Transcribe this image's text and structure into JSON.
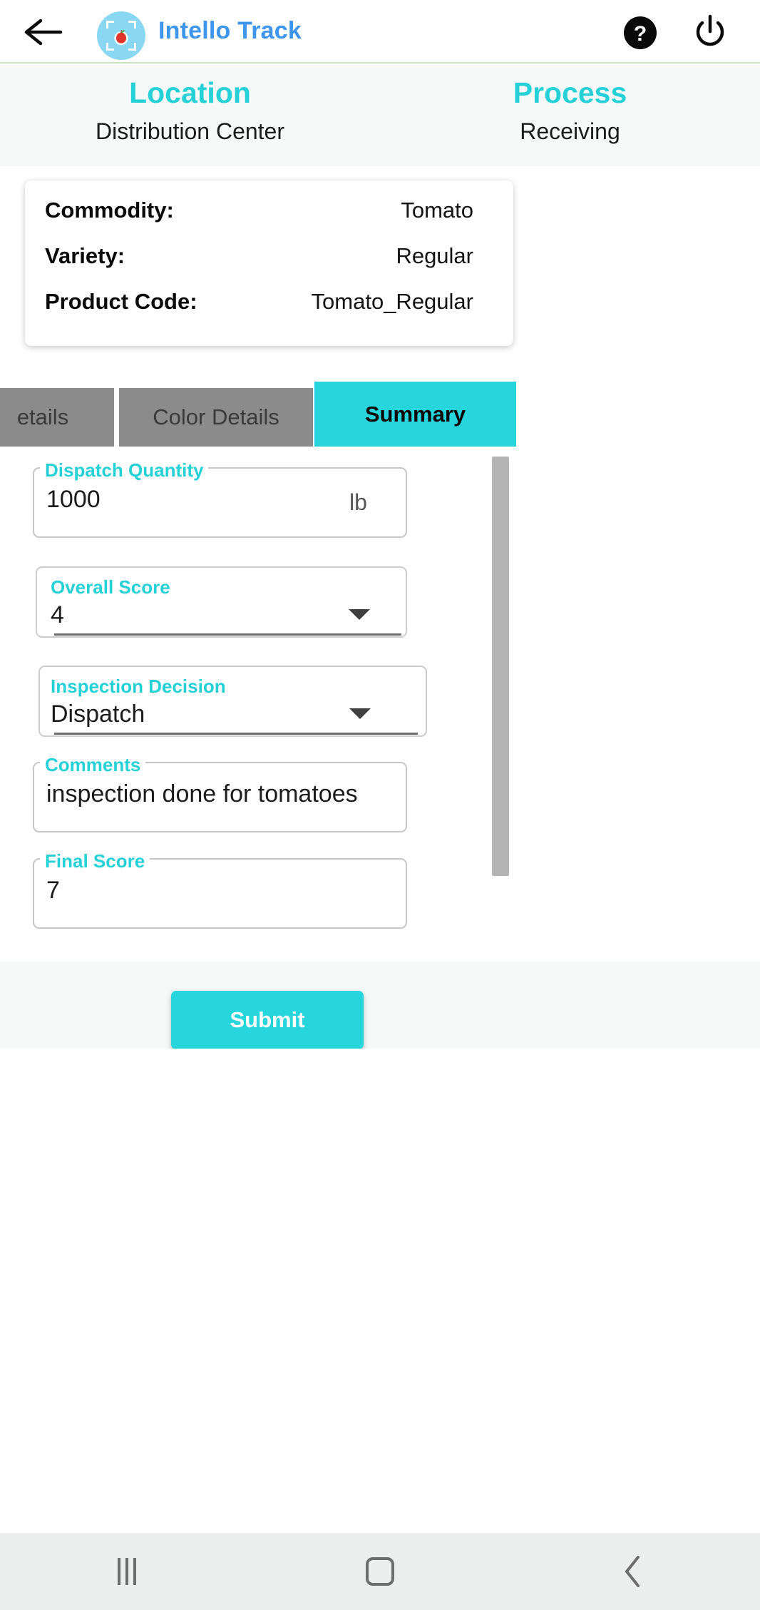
{
  "appbar": {
    "back_icon": "back-arrow-icon",
    "logo_icon": "apple-scan-logo-icon",
    "title": "Intello Track",
    "help_icon": "help-circle-icon",
    "power_icon": "power-icon",
    "title_color": "#3d95ec",
    "logo_bg_color": "#89d7f2"
  },
  "info": {
    "location_label": "Location",
    "location_value": "Distribution Center",
    "process_label": "Process",
    "process_value": "Receiving",
    "heading_color": "#25d0d6"
  },
  "commodity_card": {
    "rows": [
      {
        "label": "Commodity:",
        "value": "Tomato"
      },
      {
        "label": "Variety:",
        "value": "Regular"
      },
      {
        "label": "Product Code:",
        "value": "Tomato_Regular"
      }
    ]
  },
  "tabs": {
    "items": [
      {
        "label": "etails",
        "active": false
      },
      {
        "label": "Color Details",
        "active": false
      },
      {
        "label": "Summary",
        "active": true
      }
    ],
    "active_color": "#27d6dd",
    "inactive_color": "#8b8b8b"
  },
  "form": {
    "dispatch_quantity": {
      "label": "Dispatch Quantity",
      "value": "1000",
      "unit": "lb"
    },
    "overall_score": {
      "label": "Overall Score",
      "value": "4",
      "caret_icon": "chevron-down-icon"
    },
    "inspection_decision": {
      "label": "Inspection Decision",
      "value": "Dispatch",
      "caret_icon": "chevron-down-icon"
    },
    "comments": {
      "label": "Comments",
      "value": "inspection done for tomatoes"
    },
    "final_score": {
      "label": "Final Score",
      "value": "7"
    },
    "label_color": "#26d0d7"
  },
  "footer": {
    "submit_label": "Submit",
    "submit_color": "#27d6dd"
  },
  "navbar": {
    "recents_icon": "recents-icon",
    "home_icon": "home-icon",
    "back_icon": "back-chevron-icon"
  }
}
